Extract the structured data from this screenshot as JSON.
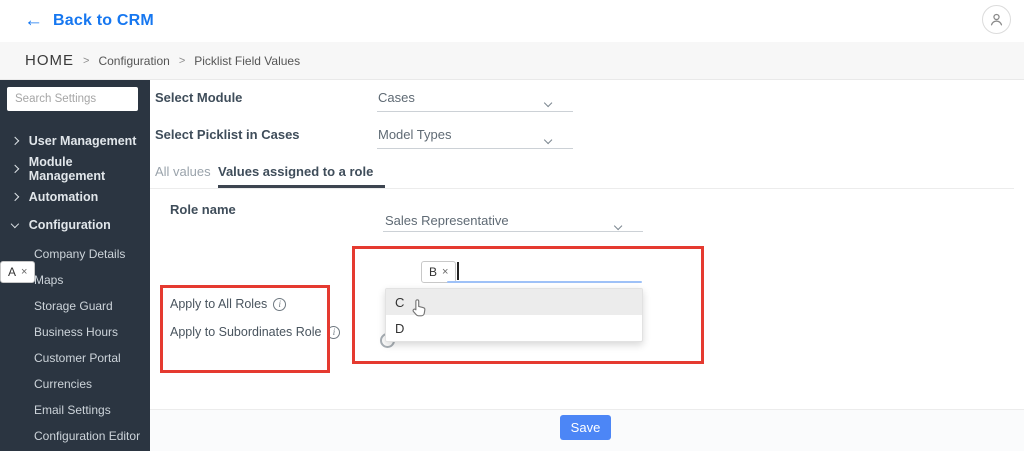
{
  "topbar": {
    "back_arrow": "←",
    "back_label": "Back to CRM"
  },
  "breadcrumb": {
    "home": "HOME",
    "separator": ">",
    "items": [
      "Configuration",
      "Picklist Field Values"
    ]
  },
  "sidebar": {
    "search_placeholder": "Search Settings",
    "items": [
      {
        "label": "User Management",
        "state": "collapsed"
      },
      {
        "label": "Module Management",
        "state": "collapsed"
      },
      {
        "label": "Automation",
        "state": "collapsed"
      },
      {
        "label": "Configuration",
        "state": "expanded"
      }
    ],
    "sub_items": [
      "Company Details",
      "Maps",
      "Storage Guard",
      "Business Hours",
      "Customer Portal",
      "Currencies",
      "Email Settings",
      "Configuration Editor"
    ]
  },
  "form": {
    "select_module_label": "Select Module",
    "select_module_value": "Cases",
    "select_picklist_label": "Select Picklist in Cases",
    "select_picklist_value": "Model Types",
    "tabs": [
      {
        "label": "All values",
        "active": false
      },
      {
        "label": "Values assigned to a role",
        "active": true
      }
    ],
    "role_name_label": "Role name",
    "role_name_value": "Sales Representative",
    "chips": [
      "A",
      "B"
    ],
    "chip_remove": "×",
    "dropdown_options": [
      "C",
      "D"
    ],
    "highlighted_option": "C",
    "apply_all_label": "Apply to All Roles",
    "apply_sub_label": "Apply to Subordinates Role",
    "save_label": "Save"
  },
  "colors": {
    "accent_blue": "#1677f0",
    "save_blue": "#4c86f6",
    "annotation_red": "#e53a30",
    "sidebar_bg": "#2b3541",
    "option_highlight": "#ececec"
  }
}
